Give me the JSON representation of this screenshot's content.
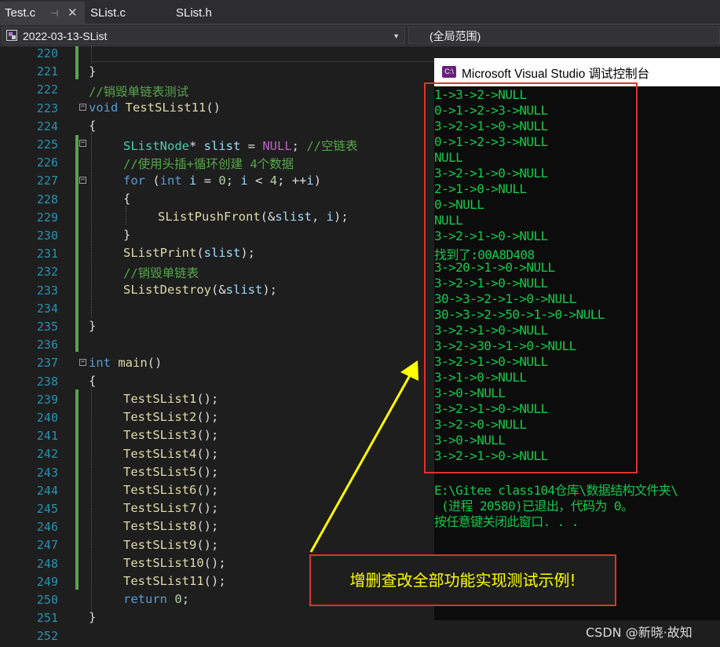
{
  "tabs": [
    {
      "label": "Test.c",
      "pin": "⊣",
      "close": "✕"
    },
    {
      "label": "SList.c"
    },
    {
      "label": "SList.h"
    }
  ],
  "navbar": {
    "project": "2022-03-13-SList",
    "scope": "(全局范围)"
  },
  "editor": {
    "line_numbers": [
      "220",
      "221",
      "222",
      "223",
      "224",
      "225",
      "226",
      "227",
      "228",
      "229",
      "230",
      "231",
      "232",
      "233",
      "234",
      "235",
      "236",
      "237",
      "238",
      "239",
      "240",
      "241",
      "242",
      "243",
      "244",
      "245",
      "246",
      "247",
      "248",
      "249",
      "250",
      "251",
      "252"
    ],
    "lines": {
      "l221": "}",
      "l222": "//销毁单链表测试",
      "l223_kw": "void",
      "l223_fn": "TestSList11",
      "l223_p": "()",
      "l224": "{",
      "l225_ty": "SListNode",
      "l225_a": "* ",
      "l225_var": "slist",
      "l225_b": " = ",
      "l225_c": "NULL",
      "l225_d": "; ",
      "l225_cm": "//空链表",
      "l226": "//使用头插+循环创建 4个数据",
      "l227_for": "for",
      "l227_a": " (",
      "l227_int": "int",
      "l227_b": " ",
      "l227_i1": "i",
      "l227_c": " = ",
      "l227_n0": "0",
      "l227_d": "; ",
      "l227_i2": "i",
      "l227_e": " < ",
      "l227_n4": "4",
      "l227_f": "; ++",
      "l227_i3": "i",
      "l227_g": ")",
      "l228": "{",
      "l229_fn": "SListPushFront",
      "l229_a": "(&",
      "l229_v": "slist",
      "l229_b": ", ",
      "l229_i": "i",
      "l229_c": ");",
      "l230": "}",
      "l231_fn": "SListPrint",
      "l231_a": "(",
      "l231_v": "slist",
      "l231_b": ");",
      "l232": "//销毁单链表",
      "l233_fn": "SListDestroy",
      "l233_a": "(&",
      "l233_v": "slist",
      "l233_b": ");",
      "l235": "}",
      "l237_kw": "int",
      "l237_fn": "main",
      "l237_p": "()",
      "l238": "{",
      "calls": [
        "TestSList1",
        "TestSList2",
        "TestSList3",
        "TestSList4",
        "TestSList5",
        "TestSList6",
        "TestSList7",
        "TestSList8",
        "TestSList9",
        "TestSList10",
        "TestSList11"
      ],
      "call_suffix": "();",
      "l250_kw": "return",
      "l250_n": "0",
      "l250_s": ";",
      "l251": "}"
    }
  },
  "console": {
    "title": "Microsoft Visual Studio 调试控制台",
    "icon_label": "C:\\",
    "output": [
      "1->3->2->NULL",
      "0->1->2->3->NULL",
      "3->2->1->0->NULL",
      "0->1->2->3->NULL",
      "NULL",
      "3->2->1->0->NULL",
      "2->1->0->NULL",
      "0->NULL",
      "NULL",
      "3->2->1->0->NULL",
      "找到了:00A8D408",
      "3->20->1->0->NULL",
      "3->2->1->0->NULL",
      "30->3->2->1->0->NULL",
      "30->3->2->50->1->0->NULL",
      "3->2->1->0->NULL",
      "3->2->30->1->0->NULL",
      "3->2->1->0->NULL",
      "3->1->0->NULL",
      "3->0->NULL",
      "3->2->1->0->NULL",
      "3->2->0->NULL",
      "3->0->NULL",
      "3->2->1->0->NULL"
    ],
    "footer": [
      "E:\\Gitee class104仓库\\数据结构文件夹\\",
      " (进程 20580)已退出，代码为 0。",
      "按任意键关闭此窗口. . ."
    ]
  },
  "annotation": {
    "callout_text": "增删查改全部功能实现测试示例!"
  },
  "watermark": "CSDN @新晓·故知",
  "colors": {
    "editor_bg": "#1e1e1e",
    "console_text": "#13c94b",
    "annotation_red": "#e0312f",
    "arrow_yellow": "#ffff00"
  }
}
